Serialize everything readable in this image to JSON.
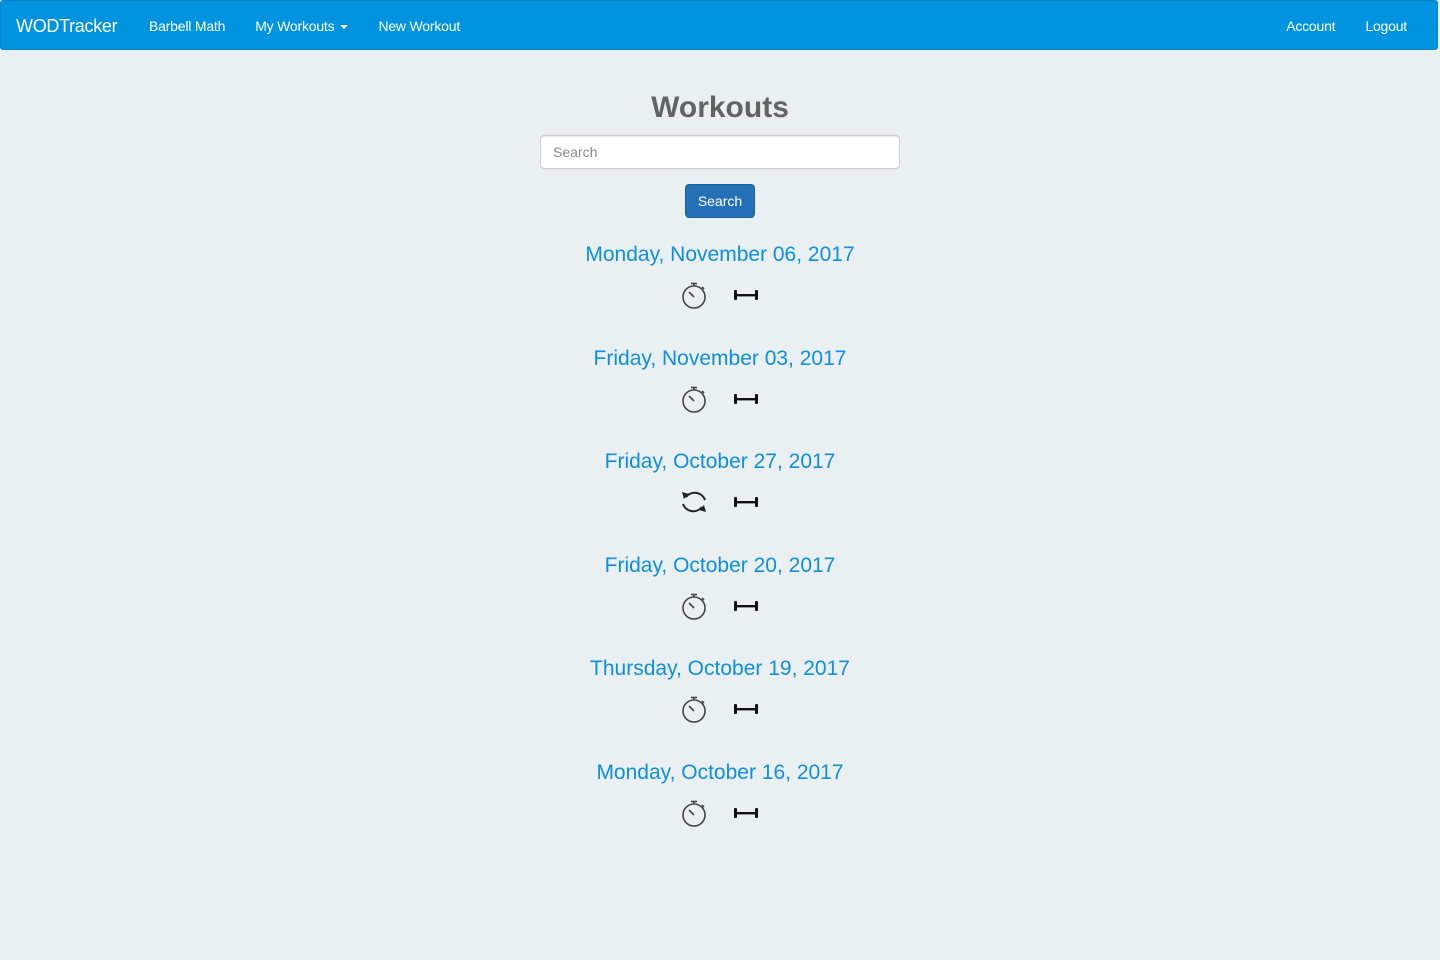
{
  "navbar": {
    "brand": "WODTracker",
    "links_left": [
      {
        "label": "Barbell Math"
      },
      {
        "label": "My Workouts"
      },
      {
        "label": "New Workout"
      }
    ],
    "links_right": [
      {
        "label": "Account"
      },
      {
        "label": "Logout"
      }
    ],
    "color": "#0094e0"
  },
  "main": {
    "title": "Workouts",
    "search": {
      "placeholder": "Search",
      "value": "",
      "button_label": "Search"
    },
    "workouts": [
      {
        "date": "Monday, November 06, 2017",
        "type_icon": "stopwatch-icon"
      },
      {
        "date": "Friday, November 03, 2017",
        "type_icon": "stopwatch-icon"
      },
      {
        "date": "Friday, October 27, 2017",
        "type_icon": "refresh-icon"
      },
      {
        "date": "Friday, October 20, 2017",
        "type_icon": "stopwatch-icon"
      },
      {
        "date": "Thursday, October 19, 2017",
        "type_icon": "stopwatch-icon"
      },
      {
        "date": "Monday, October 16, 2017",
        "type_icon": "stopwatch-icon"
      }
    ],
    "equipment_icon": "barbell-icon"
  },
  "colors": {
    "background": "#eaf0f1",
    "link": "#0e8ee0",
    "button": "#2471b8",
    "title": "#636363"
  }
}
